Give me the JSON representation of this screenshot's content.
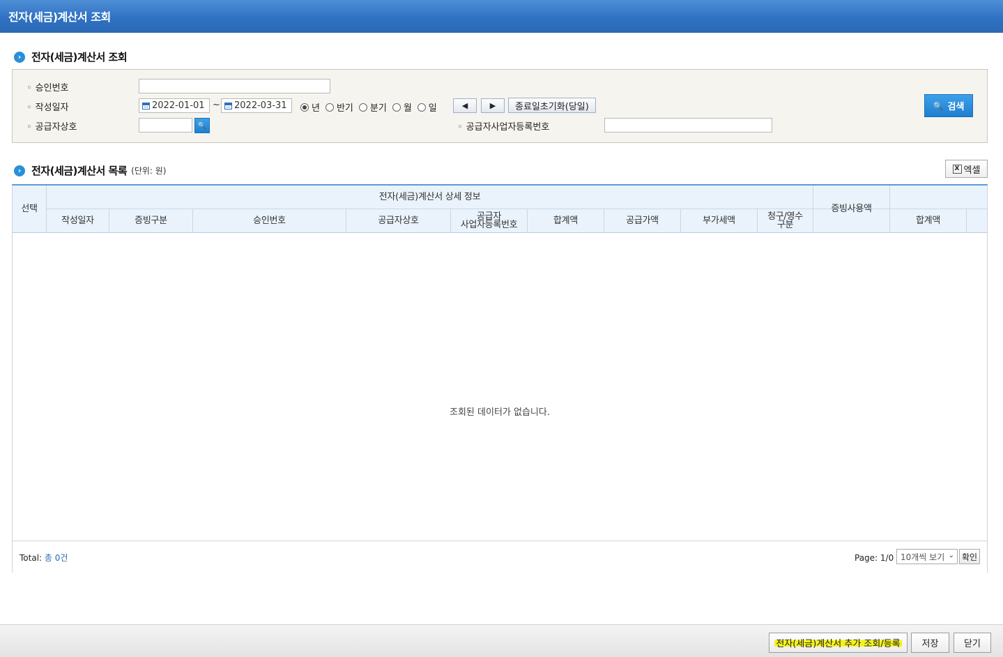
{
  "window": {
    "title": "전자(세금)계산서 조회"
  },
  "search_section": {
    "title": "전자(세금)계산서 조회",
    "approval_no_label": "승인번호",
    "approval_no_value": "",
    "date_label": "작성일자",
    "date_from": "2022-01-01",
    "date_tilde": "~",
    "date_to": "2022-03-31",
    "period_options": [
      {
        "label": "년",
        "selected": true
      },
      {
        "label": "반기",
        "selected": false
      },
      {
        "label": "분기",
        "selected": false
      },
      {
        "label": "월",
        "selected": false
      },
      {
        "label": "일",
        "selected": false
      }
    ],
    "prev_glyph": "◀",
    "next_glyph": "▶",
    "reset_end_label": "종료일초기화(당일)",
    "supplier_name_label": "공급자상호",
    "supplier_name_value": "",
    "supplier_regno_label": "공급자사업자등록번호",
    "supplier_regno_value": "",
    "search_button": "검색"
  },
  "list_section": {
    "title": "전자(세금)계산서 목록",
    "unit": "(단위: 원)",
    "excel_button": "엑셀",
    "columns": {
      "select": "선택",
      "detail_group": "전자(세금)계산서 상세 정보",
      "write_date": "작성일자",
      "evidence_type": "증빙구분",
      "approval_no": "승인번호",
      "supplier_name": "공급자상호",
      "supplier_regno_1": "공급자",
      "supplier_regno_2": "사업자등록번호",
      "total": "합계액",
      "supply_amount": "공급가액",
      "vat": "부가세액",
      "claim_1": "청구/영수",
      "claim_2": "구분",
      "evidence_used": "증빙사용액",
      "total2": "합계액"
    },
    "empty_message": "조회된 데이터가 없습니다.",
    "total_label": "Total:",
    "total_count": "총 0건",
    "page_info": "Page: 1/0",
    "page_size": "10개씩 보기",
    "confirm_button": "확인"
  },
  "footer": {
    "add_register_button": "전자(세금)계산서 추가 조회/등록",
    "save_button": "저장",
    "close_button": "닫기"
  },
  "colors": {
    "accent": "#2f72c3",
    "header_bg": "#eaf3fc",
    "highlight": "#f5f21a"
  }
}
